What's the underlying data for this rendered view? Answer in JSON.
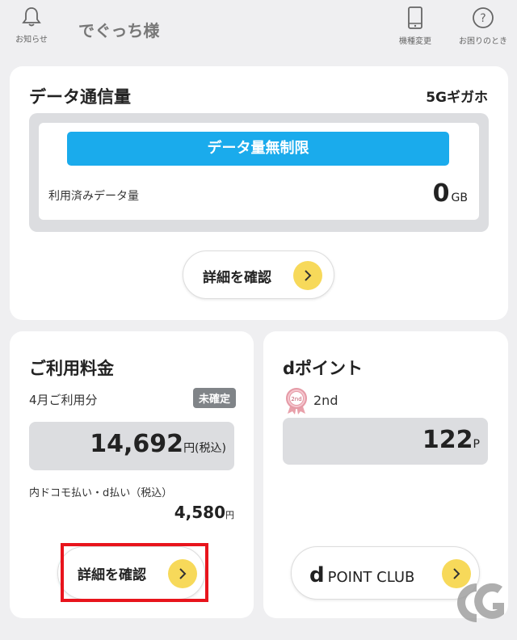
{
  "header": {
    "user_name": "でぐっち様",
    "notifications_label": "お知らせ",
    "device_change_label": "機種変更",
    "help_label": "お困りのとき"
  },
  "data_card": {
    "title": "データ通信量",
    "plan": "5Gギガホ",
    "unlimited_banner": "データ量無制限",
    "used_label": "利用済みデータ量",
    "used_value": "0",
    "used_unit": "GB",
    "detail_button": "詳細を確認"
  },
  "fee_card": {
    "title": "ご利用料金",
    "month_label": "4月ご利用分",
    "status_badge": "未確定",
    "amount": "14,692",
    "amount_unit": "円(税込)",
    "docomo_label": "内ドコモ払い・d払い（税込）",
    "docomo_amount": "4,580",
    "docomo_unit": "円",
    "detail_button": "詳細を確認"
  },
  "point_card": {
    "title": "dポイント",
    "rank_badge": "2nd",
    "rank_text": "2nd",
    "points": "122",
    "points_unit": "P",
    "club_d": "d",
    "club_name": "POINT CLUB"
  },
  "colors": {
    "accent_blue": "#1aabec",
    "arrow_yellow": "#f7d95a",
    "highlight_red": "#e8141c",
    "badge_gray": "#808488"
  }
}
